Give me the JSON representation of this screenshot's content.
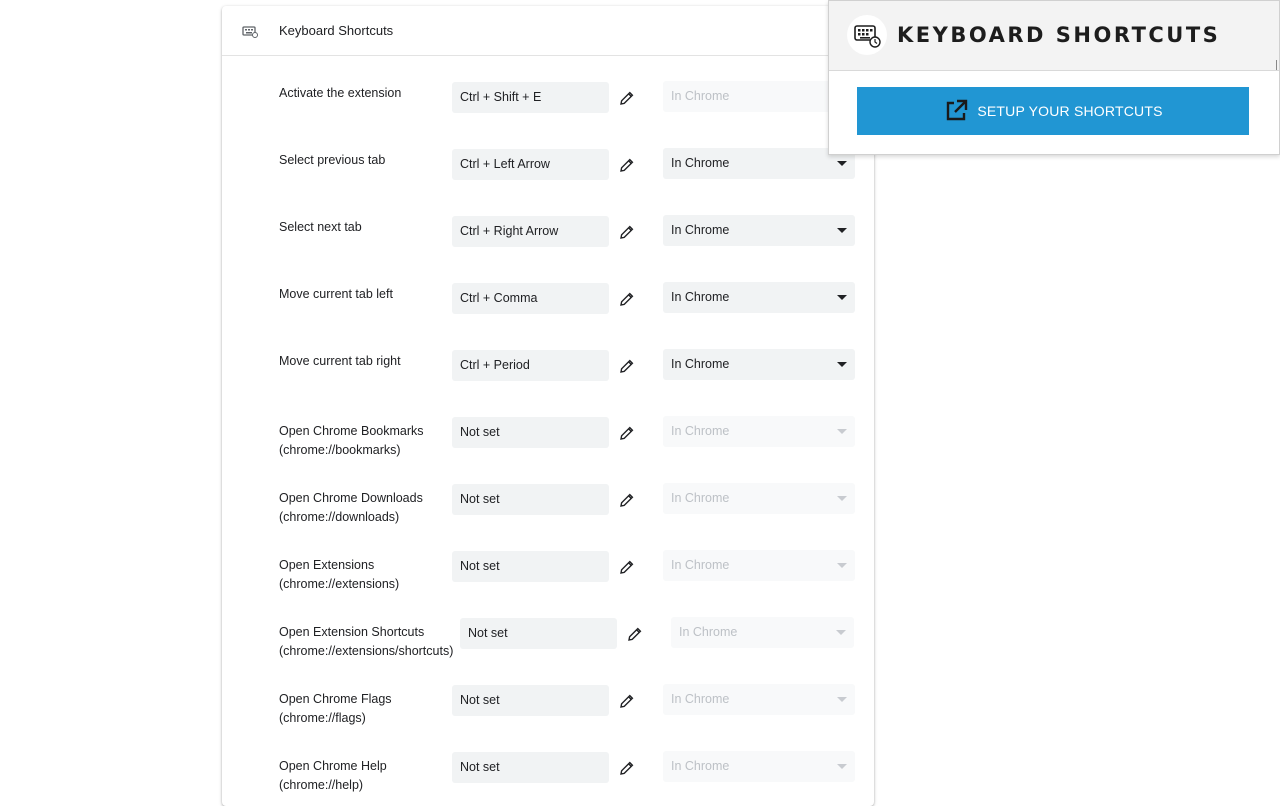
{
  "card": {
    "title": "Keyboard Shortcuts",
    "title_icon": "keyboard-icon"
  },
  "rows": [
    {
      "label": "Activate the extension",
      "sub": "",
      "value": "Ctrl + Shift + E",
      "scope": "In Chrome",
      "scope_enabled": false,
      "caret": false
    },
    {
      "label": "Select previous tab",
      "sub": "",
      "value": "Ctrl + Left Arrow",
      "scope": "In Chrome",
      "scope_enabled": true,
      "caret": true
    },
    {
      "label": "Select next tab",
      "sub": "",
      "value": "Ctrl + Right Arrow",
      "scope": "In Chrome",
      "scope_enabled": true,
      "caret": true
    },
    {
      "label": "Move current tab left",
      "sub": "",
      "value": "Ctrl + Comma",
      "scope": "In Chrome",
      "scope_enabled": true,
      "caret": true
    },
    {
      "label": "Move current tab right",
      "sub": "",
      "value": "Ctrl + Period",
      "scope": "In Chrome",
      "scope_enabled": true,
      "caret": true
    },
    {
      "label": "Open Chrome Bookmarks",
      "sub": "(chrome://bookmarks)",
      "value": "Not set",
      "scope": "In Chrome",
      "scope_enabled": false,
      "caret": true
    },
    {
      "label": "Open Chrome Downloads",
      "sub": "(chrome://downloads)",
      "value": "Not set",
      "scope": "In Chrome",
      "scope_enabled": false,
      "caret": true
    },
    {
      "label": "Open Extensions",
      "sub": "(chrome://extensions)",
      "value": "Not set",
      "scope": "In Chrome",
      "scope_enabled": false,
      "caret": true
    },
    {
      "label": "Open Extension Shortcuts",
      "sub": "(chrome://extensions/shortcuts)",
      "value": "Not set",
      "scope": "In Chrome",
      "scope_enabled": false,
      "caret": true
    },
    {
      "label": "Open Chrome Flags",
      "sub": "(chrome://flags)",
      "value": "Not set",
      "scope": "In Chrome",
      "scope_enabled": false,
      "caret": true
    },
    {
      "label": "Open Chrome Help",
      "sub": "(chrome://help)",
      "value": "Not set",
      "scope": "In Chrome",
      "scope_enabled": false,
      "caret": true
    }
  ],
  "popup": {
    "title": "KEYBOARD SHORTCUTS",
    "logo_icon": "keyboard-logo-icon",
    "button_label": "SETUP YOUR SHORTCUTS",
    "button_icon": "external-link-icon",
    "button_color": "#2196d3"
  }
}
